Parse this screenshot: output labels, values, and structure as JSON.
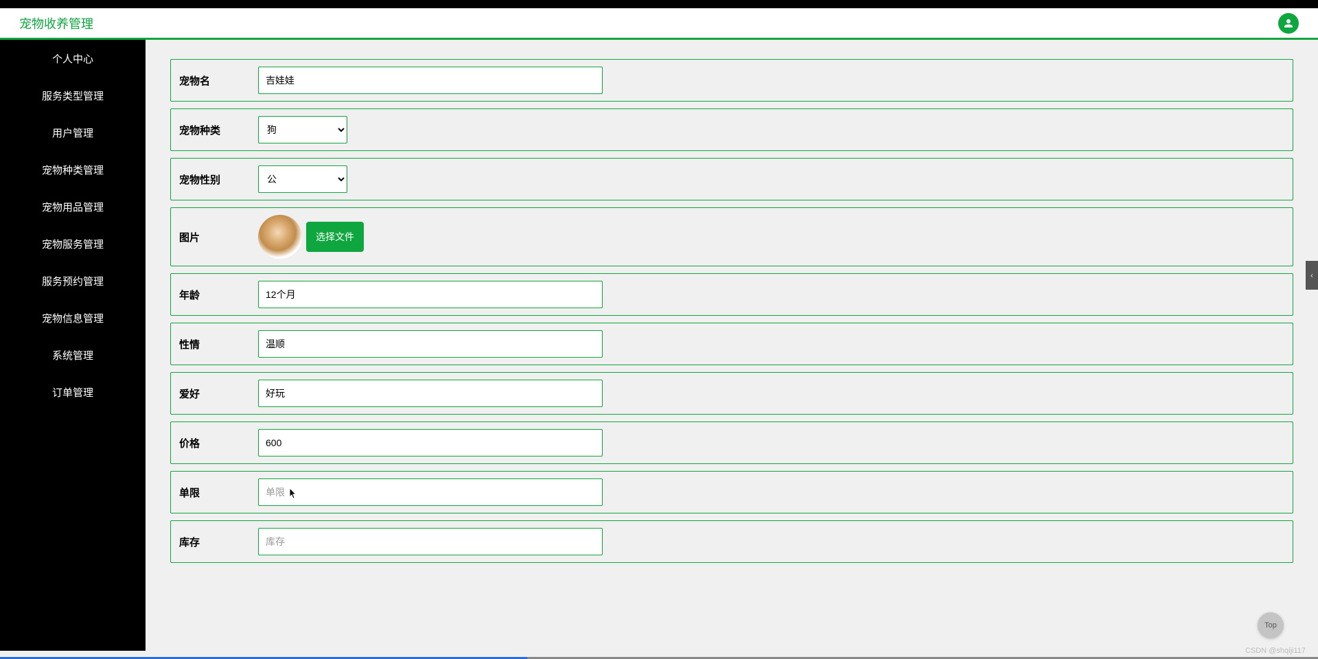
{
  "header": {
    "title": "宠物收养管理"
  },
  "sidebar": {
    "items": [
      {
        "label": "个人中心"
      },
      {
        "label": "服务类型管理"
      },
      {
        "label": "用户管理"
      },
      {
        "label": "宠物种类管理"
      },
      {
        "label": "宠物用品管理"
      },
      {
        "label": "宠物服务管理"
      },
      {
        "label": "服务预约管理"
      },
      {
        "label": "宠物信息管理"
      },
      {
        "label": "系统管理"
      },
      {
        "label": "订单管理"
      }
    ]
  },
  "form": {
    "pet_name": {
      "label": "宠物名",
      "value": "吉娃娃"
    },
    "pet_type": {
      "label": "宠物种类",
      "selected": "狗"
    },
    "pet_gender": {
      "label": "宠物性别",
      "selected": "公"
    },
    "image": {
      "label": "图片",
      "button": "选择文件"
    },
    "age": {
      "label": "年龄",
      "value": "12个月"
    },
    "temperament": {
      "label": "性情",
      "value": "温顺"
    },
    "hobby": {
      "label": "爱好",
      "value": "好玩"
    },
    "price": {
      "label": "价格",
      "value": "600"
    },
    "single_limit": {
      "label": "单限",
      "value": "",
      "placeholder": "单限"
    },
    "stock": {
      "label": "库存",
      "value": "",
      "placeholder": "库存"
    }
  },
  "top_button": "Top",
  "watermark": "CSDN @shqiji117"
}
